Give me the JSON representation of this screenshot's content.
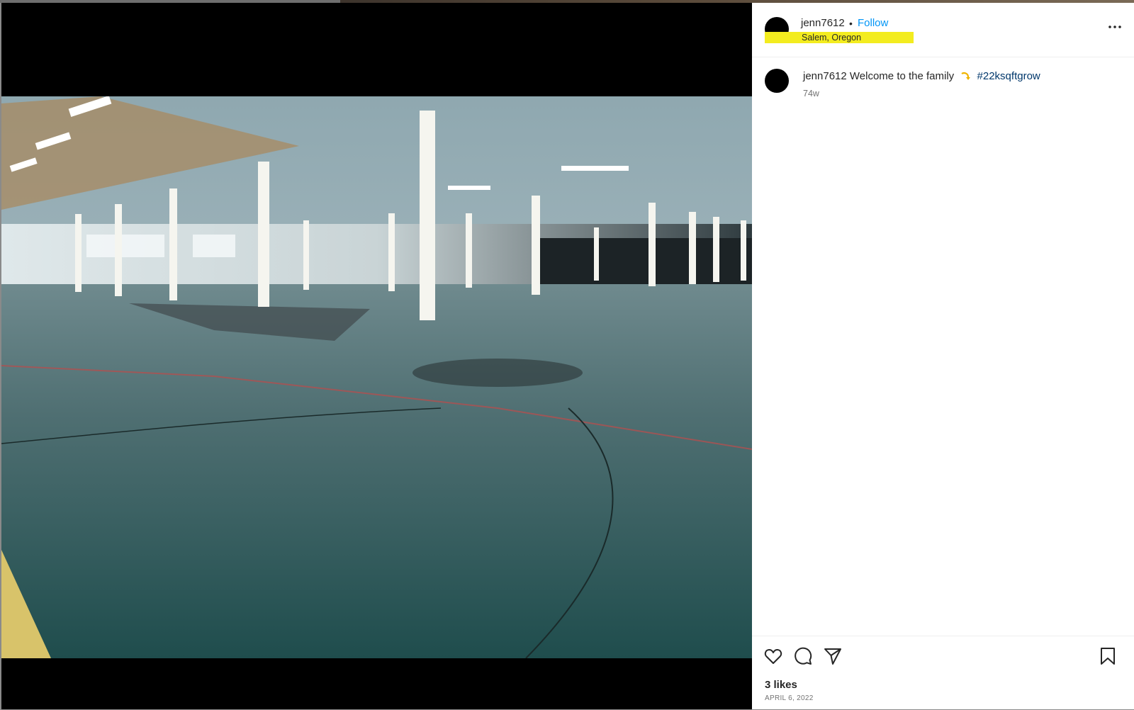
{
  "post": {
    "username": "jenn7612",
    "separator": "•",
    "follow_label": "Follow",
    "location": "Salem, Oregon",
    "caption": {
      "username": "jenn7612",
      "text": "Welcome to the family",
      "emoji": "hooking-arrow-emoji",
      "hashtag": "#22ksqftgrow"
    },
    "time_ago": "74w",
    "likes": "3 likes",
    "date": "APRIL 6, 2022"
  },
  "media": {
    "description_icon": "warehouse-photo"
  },
  "icons": {
    "more": "more-options-icon",
    "like": "heart-icon",
    "comment": "comment-icon",
    "share": "share-icon",
    "save": "bookmark-icon"
  },
  "colors": {
    "follow": "#0095f6",
    "hashtag": "#00376b",
    "highlight": "#f3ec1f",
    "text": "#262626",
    "muted": "#737373"
  }
}
